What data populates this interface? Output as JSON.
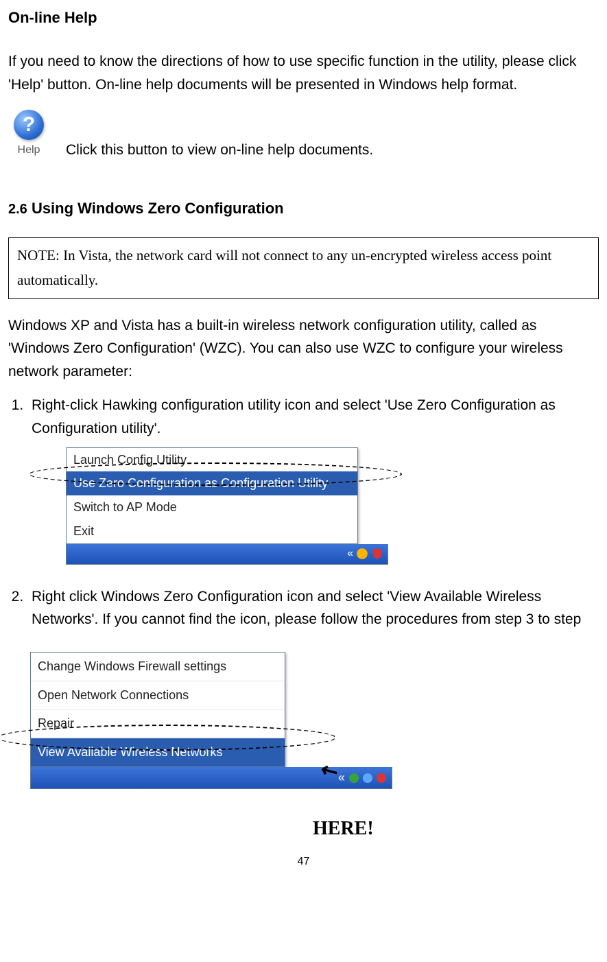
{
  "headings": {
    "online_help": "On-line Help",
    "section_prefix": "2.6",
    "section_title": "Using Windows Zero Configuration"
  },
  "paragraphs": {
    "online_help_desc": "If you need to know the directions of how to use specific function in the utility, please click 'Help' button. On-line help documents will be presented in Windows help format.",
    "help_button_desc": "Click this button to view on-line help documents.",
    "wzc_desc": "Windows XP and Vista has a built-in wireless network configuration utility, called as 'Windows Zero Configuration' (WZC). You can also use WZC to configure your wireless network parameter:"
  },
  "note": "NOTE: In Vista, the network card will not connect to any un-encrypted wireless access point automatically.",
  "steps": [
    "Right-click Hawking configuration utility icon and select 'Use Zero Configuration as Configuration utility'.",
    "Right click Windows Zero Configuration icon and select 'View Available Wireless Networks'. If you cannot find the icon, please follow the procedures from step 3 to step"
  ],
  "help_button": {
    "glyph": "?",
    "label": "Help"
  },
  "menu1": {
    "items": [
      "Launch Config Utility",
      "Use Zero Configuration as Configuration Utility",
      "Switch to AP Mode",
      "Exit"
    ],
    "highlighted_index": 1,
    "taskbar_caret": "«"
  },
  "menu2": {
    "items": [
      "Change Windows Firewall settings",
      "Open Network Connections",
      "Repair",
      "View Available Wireless Networks"
    ],
    "highlighted_index": 3,
    "taskbar_caret": "«"
  },
  "annotation": {
    "here": "HERE!",
    "arrow": "↖"
  },
  "page_number": "47"
}
